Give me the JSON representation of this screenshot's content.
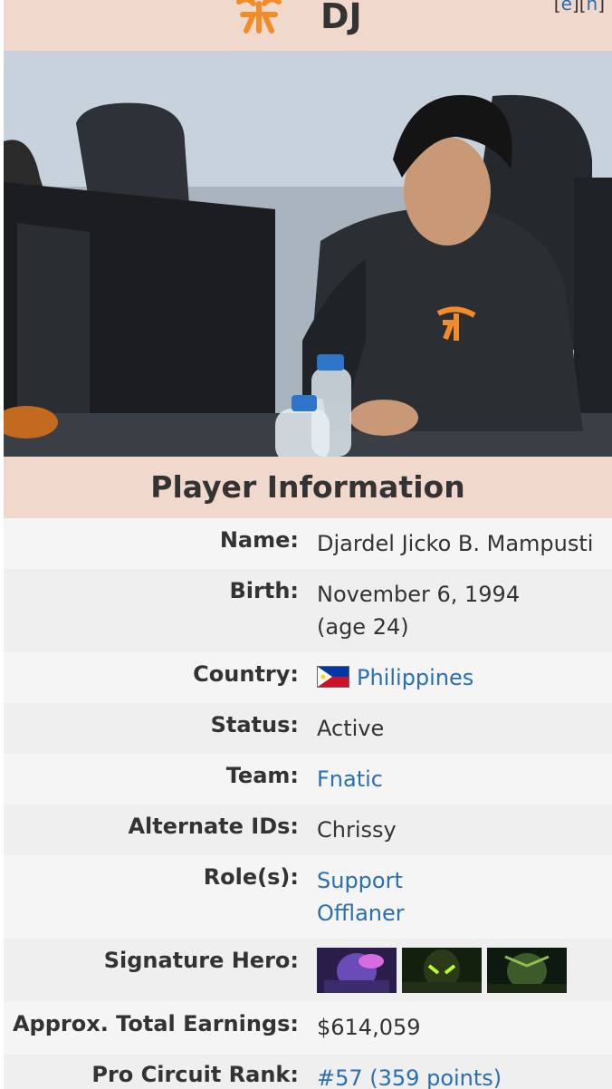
{
  "header": {
    "title": "DJ",
    "edit_links": {
      "open": "[",
      "e": "e",
      "mid": "][",
      "h": "h",
      "close": "]"
    }
  },
  "photo": {
    "description_icon": "player-photo"
  },
  "section": {
    "title": "Player Information"
  },
  "info": {
    "name": {
      "label": "Name:",
      "value": "Djardel Jicko B. Mampusti"
    },
    "birth": {
      "label": "Birth:",
      "value_line1": "November 6, 1994",
      "value_line2": "(age 24)"
    },
    "country": {
      "label": "Country:",
      "value": "Philippines",
      "flag_icon": "philippines-flag-icon"
    },
    "status": {
      "label": "Status:",
      "value": "Active"
    },
    "team": {
      "label": "Team:",
      "value": "Fnatic"
    },
    "alternate_ids": {
      "label": "Alternate IDs:",
      "value": "Chrissy"
    },
    "roles": {
      "label": "Role(s):",
      "value_line1": "Support",
      "value_line2": "Offlaner"
    },
    "signature_hero": {
      "label": "Signature Hero:",
      "heroes": [
        "hero-icon-1",
        "hero-icon-2",
        "hero-icon-3"
      ]
    },
    "earnings": {
      "label": "Approx. Total Earnings:",
      "value": "$614,059"
    },
    "pro_circuit": {
      "label": "Pro Circuit Rank:",
      "value": "#57 (359 points)"
    }
  },
  "colors": {
    "header_bg": "#f1d8cc",
    "link": "#2a6fb0",
    "row_alt": "#efefef",
    "row_plain": "#f5f5f5",
    "logo": "#f28c28"
  }
}
